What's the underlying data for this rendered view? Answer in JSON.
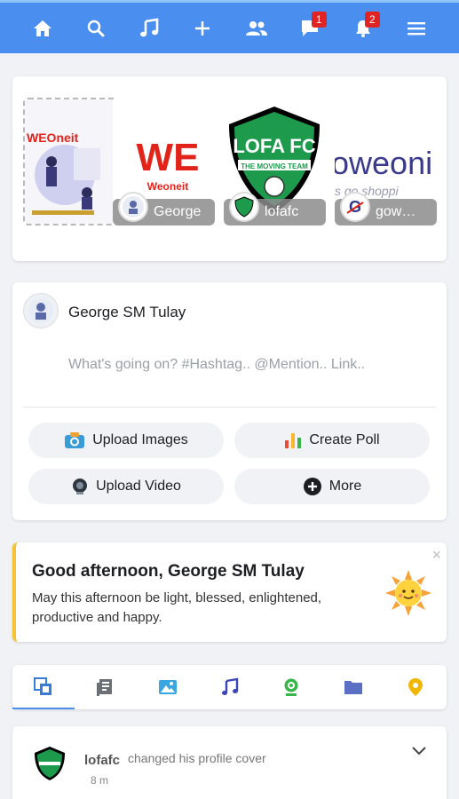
{
  "nav": {
    "items": [
      {
        "icon": "home-icon"
      },
      {
        "icon": "search-icon"
      },
      {
        "icon": "music-icon"
      },
      {
        "icon": "plus-icon"
      },
      {
        "icon": "friends-icon"
      },
      {
        "icon": "messages-icon",
        "badge": "1"
      },
      {
        "icon": "notifications-icon",
        "badge": "2"
      },
      {
        "icon": "menu-icon"
      }
    ],
    "bar_color": "#4a8ff0"
  },
  "stories": {
    "items": [
      {
        "label": "",
        "thumb_text": "WEOneit"
      },
      {
        "label": "George",
        "thumb_text": "WE",
        "thumb_sub": "Weoneit"
      },
      {
        "label": "lofafc",
        "thumb_text": "LOFA FC",
        "thumb_sub": "THE MOVING TEAM"
      },
      {
        "label": "gow…",
        "thumb_text": "oweoni",
        "thumb_sub": "s go shoppi"
      }
    ]
  },
  "composer": {
    "user_name": "George SM Tulay",
    "placeholder": "What's going on? #Hashtag.. @Mention.. Link..",
    "actions": {
      "upload_images": "Upload Images",
      "create_poll": "Create Poll",
      "upload_video": "Upload Video",
      "more": "More"
    }
  },
  "greeting": {
    "title": "Good afternoon, George SM Tulay",
    "message": "May this afternoon be light, blessed, enlightened, productive and happy.",
    "close": "×",
    "accent": "#f5c431"
  },
  "filter_tabs": [
    {
      "icon": "all-posts-icon",
      "active": true
    },
    {
      "icon": "text-posts-icon"
    },
    {
      "icon": "photos-icon"
    },
    {
      "icon": "music-icon"
    },
    {
      "icon": "video-icon"
    },
    {
      "icon": "files-icon"
    },
    {
      "icon": "location-icon"
    }
  ],
  "activity": {
    "user": "lofafc",
    "action": "changed his profile cover",
    "time": "8 m"
  }
}
